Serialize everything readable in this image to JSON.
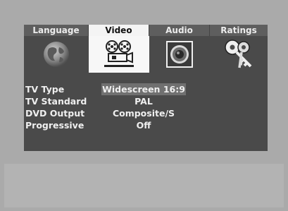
{
  "tabs": [
    {
      "label": "Language",
      "icon": "globe-icon",
      "active": false
    },
    {
      "label": "Video",
      "icon": "film-projector-icon",
      "active": true
    },
    {
      "label": "Audio",
      "icon": "speaker-icon",
      "active": false
    },
    {
      "label": "Ratings",
      "icon": "keys-icon",
      "active": false
    }
  ],
  "settings": [
    {
      "label": "TV Type",
      "value": "Widescreen 16:9",
      "selected": true
    },
    {
      "label": "TV Standard",
      "value": "PAL",
      "selected": false
    },
    {
      "label": "DVD Output",
      "value": "Composite/S",
      "selected": false
    },
    {
      "label": "Progressive",
      "value": "Off",
      "selected": false
    }
  ],
  "colors": {
    "panel": "#4a4a4a",
    "active_tab": "#f4f4f4",
    "selected_value": "#707070",
    "text": "#efefef"
  }
}
